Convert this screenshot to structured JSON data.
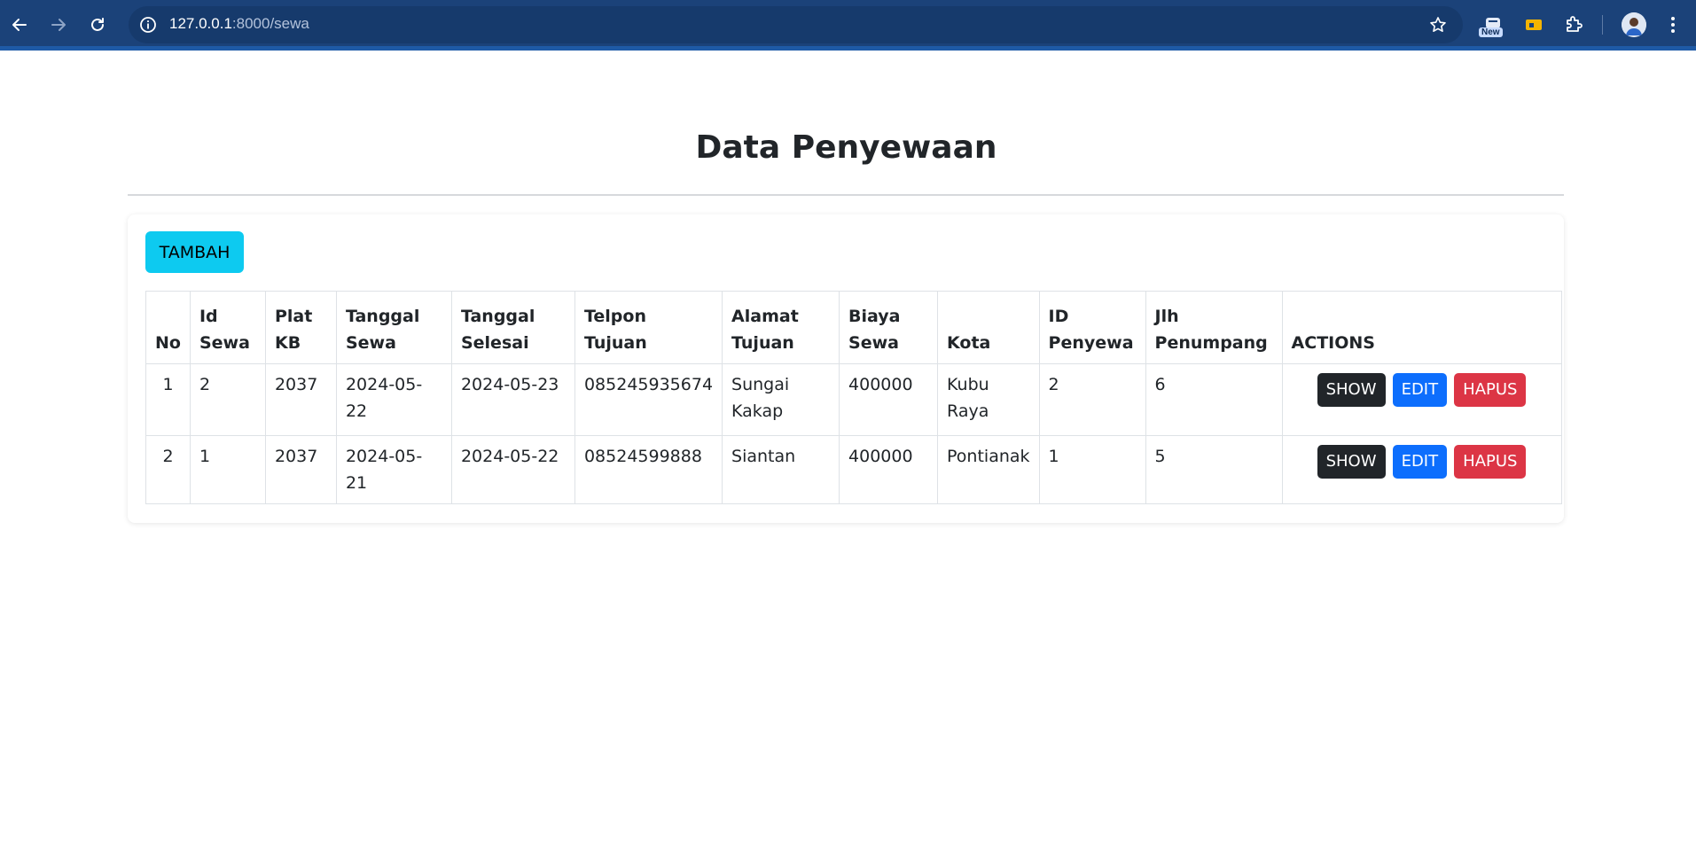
{
  "browser": {
    "url_host": "127.0.0.1",
    "url_path": ":8000/sewa",
    "new_badge": "New",
    "icons": [
      "back-icon",
      "forward-icon",
      "reload-icon",
      "site-info-icon",
      "bookmark-star-icon",
      "new-feature-icon",
      "extension-icon",
      "puzzle-extensions-icon",
      "profile-avatar",
      "kebab-menu-icon"
    ]
  },
  "page": {
    "title": "Data Penyewaan",
    "add_button": "TAMBAH"
  },
  "table": {
    "headers": {
      "no": "No",
      "id_sewa_1": "Id",
      "id_sewa_2": "Sewa",
      "plat_1": "Plat",
      "plat_2": "KB",
      "tgl_sewa_1": "Tanggal",
      "tgl_sewa_2": "Sewa",
      "tgl_selesai_1": "Tanggal",
      "tgl_selesai_2": "Selesai",
      "telpon_1": "Telpon",
      "telpon_2": "Tujuan",
      "alamat_1": "Alamat",
      "alamat_2": "Tujuan",
      "biaya_1": "Biaya",
      "biaya_2": "Sewa",
      "kota": "Kota",
      "id_penyewa_1": "ID",
      "id_penyewa_2": "Penyewa",
      "jlh_1": "Jlh",
      "jlh_2": "Penumpang",
      "actions": "ACTIONS"
    },
    "rows": [
      {
        "no": "1",
        "id_sewa": "2",
        "plat": "2037",
        "tanggal_sewa": "2024-05-22",
        "tanggal_selesai": "2024-05-23",
        "telpon": "085245935674",
        "alamat_1": "Sungai",
        "alamat_2": "Kakap",
        "biaya": "400000",
        "kota_1": "Kubu",
        "kota_2": "Raya",
        "id_penyewa": "2",
        "jlh_penumpang": "6"
      },
      {
        "no": "2",
        "id_sewa": "1",
        "plat": "2037",
        "tanggal_sewa": "2024-05-21",
        "tanggal_selesai": "2024-05-22",
        "telpon": "08524599888",
        "alamat_1": "Siantan",
        "alamat_2": "",
        "biaya": "400000",
        "kota_1": "Pontianak",
        "kota_2": "",
        "id_penyewa": "1",
        "jlh_penumpang": "5"
      }
    ],
    "actions": {
      "show": "SHOW",
      "edit": "EDIT",
      "hapus": "HAPUS"
    }
  },
  "colors": {
    "chrome": "#1b4279",
    "info_button": "#0dcaf0",
    "show_button": "#212529",
    "edit_button": "#0d6efd",
    "hapus_button": "#dc3545"
  }
}
